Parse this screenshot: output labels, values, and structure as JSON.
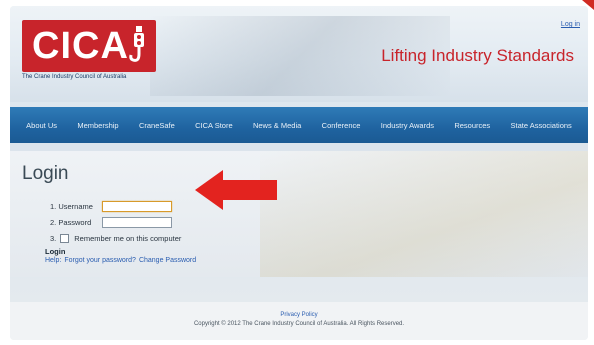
{
  "header": {
    "logo_text": "CICA",
    "logo_tagline": "The Crane Industry Council of Australia",
    "login_link": "Log in",
    "tagline": "Lifting Industry Standards"
  },
  "nav": {
    "items": [
      "About Us",
      "Membership",
      "CraneSafe",
      "CICA Store",
      "News & Media",
      "Conference",
      "Industry Awards",
      "Resources",
      "State Associations"
    ]
  },
  "login": {
    "title": "Login",
    "username_label": "1. Username",
    "username_value": "",
    "password_label": "2. Password",
    "password_value": "",
    "remember_num": "3.",
    "remember_label": "Remember me on this computer",
    "submit_label": "Login",
    "help_prefix": "Help:",
    "forgot_link": "Forgot your password?",
    "change_link": "Change Password"
  },
  "footer": {
    "privacy": "Privacy Policy",
    "copyright": "Copyright © 2012 The Crane Industry Council of Australia. All Rights Reserved."
  },
  "colors": {
    "brand_red": "#c8242b",
    "nav_blue": "#1f63a0",
    "link_blue": "#2a5db0",
    "arrow_red": "#e3231f"
  }
}
